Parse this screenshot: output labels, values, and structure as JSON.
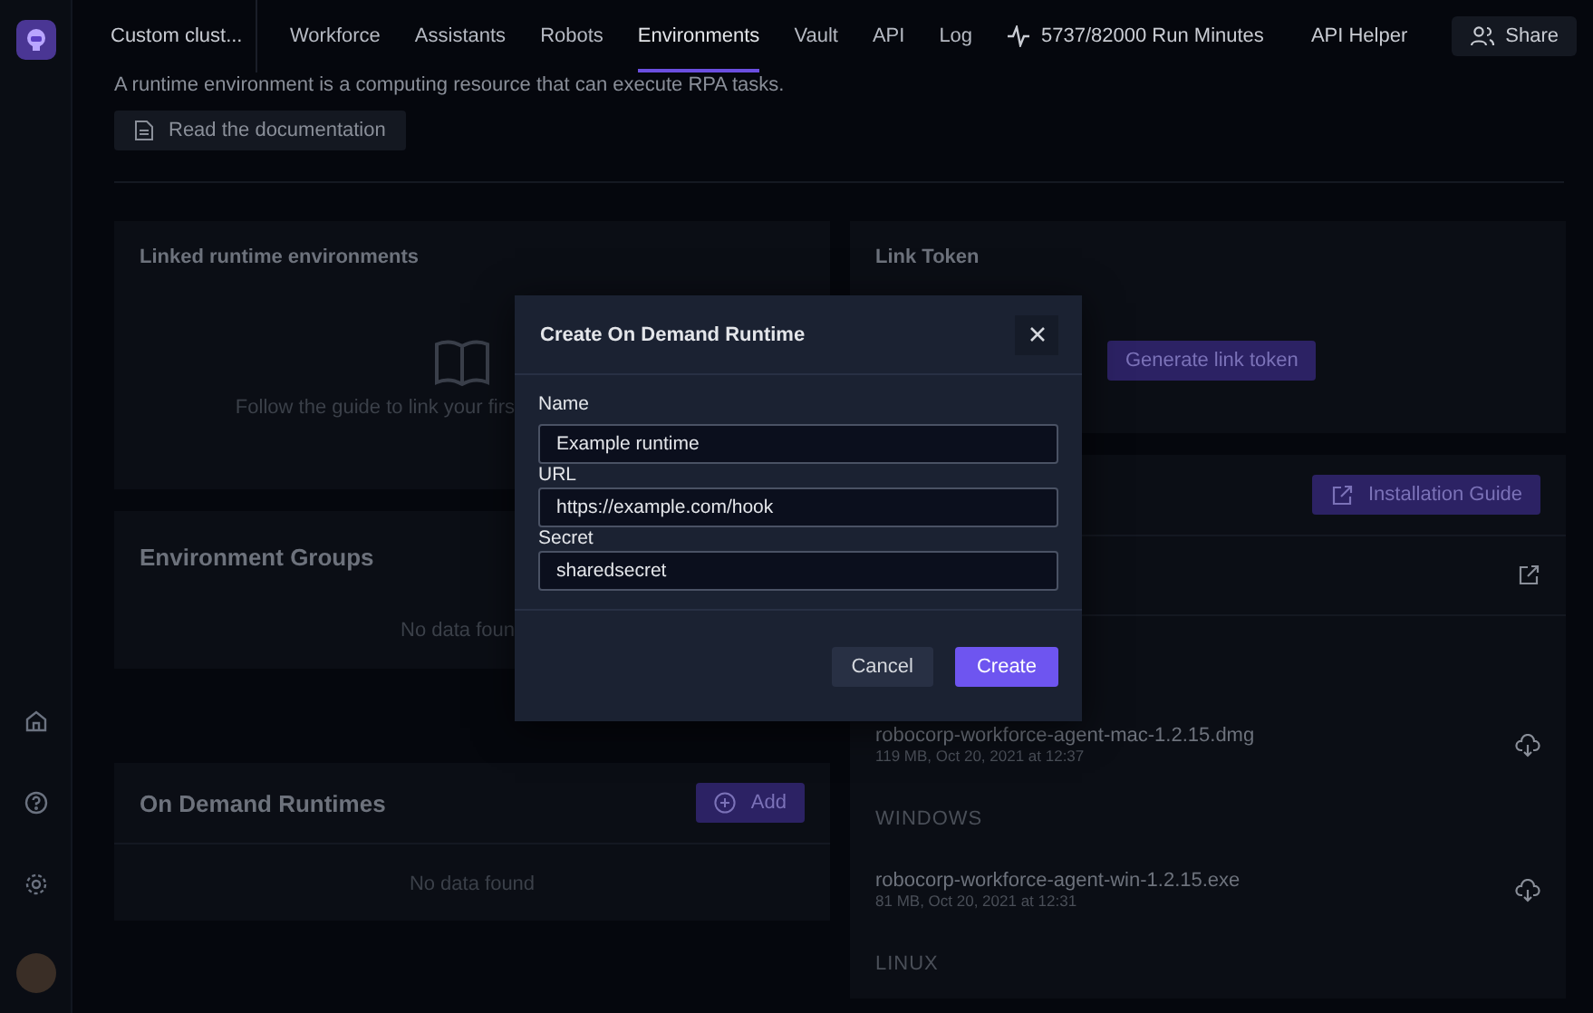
{
  "topbar": {
    "workspace": "Custom clust...",
    "tabs": [
      {
        "label": "Workforce",
        "selected": false
      },
      {
        "label": "Assistants",
        "selected": false
      },
      {
        "label": "Robots",
        "selected": false
      },
      {
        "label": "Environments",
        "selected": true
      },
      {
        "label": "Vault",
        "selected": false
      },
      {
        "label": "API",
        "selected": false
      },
      {
        "label": "Log",
        "selected": false
      }
    ],
    "run_minutes": "5737/82000 Run Minutes",
    "api_helper": "API Helper",
    "share": "Share"
  },
  "intro": {
    "text": "A runtime environment is a computing resource that can execute RPA tasks.",
    "doc_button": "Read the documentation"
  },
  "linked_card": {
    "title": "Linked runtime environments",
    "empty_text": "Follow the guide to link your firs"
  },
  "groups_card": {
    "title": "Environment Groups",
    "empty_text": "No data foun"
  },
  "on_demand_card": {
    "title": "On Demand Runtimes",
    "add_button": "Add",
    "empty_text": "No data found"
  },
  "link_token_card": {
    "title": "Link Token",
    "button": "Generate link token"
  },
  "agent_card": {
    "guide_button": "Installation Guide",
    "sections": [
      {
        "files": [
          {
            "name": "robocorp-workforce-agent-mac-1.2.15.dmg",
            "meta": "119 MB, Oct 20, 2021 at 12:37"
          }
        ]
      },
      {
        "label": "WINDOWS",
        "files": [
          {
            "name": "robocorp-workforce-agent-win-1.2.15.exe",
            "meta": "81 MB, Oct 20, 2021 at 12:31"
          }
        ]
      },
      {
        "label": "LINUX"
      }
    ]
  },
  "modal": {
    "title": "Create On Demand Runtime",
    "fields": [
      {
        "label": "Name",
        "value": "Example runtime"
      },
      {
        "label": "URL",
        "value": "https://example.com/hook"
      },
      {
        "label": "Secret",
        "value": "sharedsecret"
      }
    ],
    "cancel": "Cancel",
    "create": "Create"
  }
}
